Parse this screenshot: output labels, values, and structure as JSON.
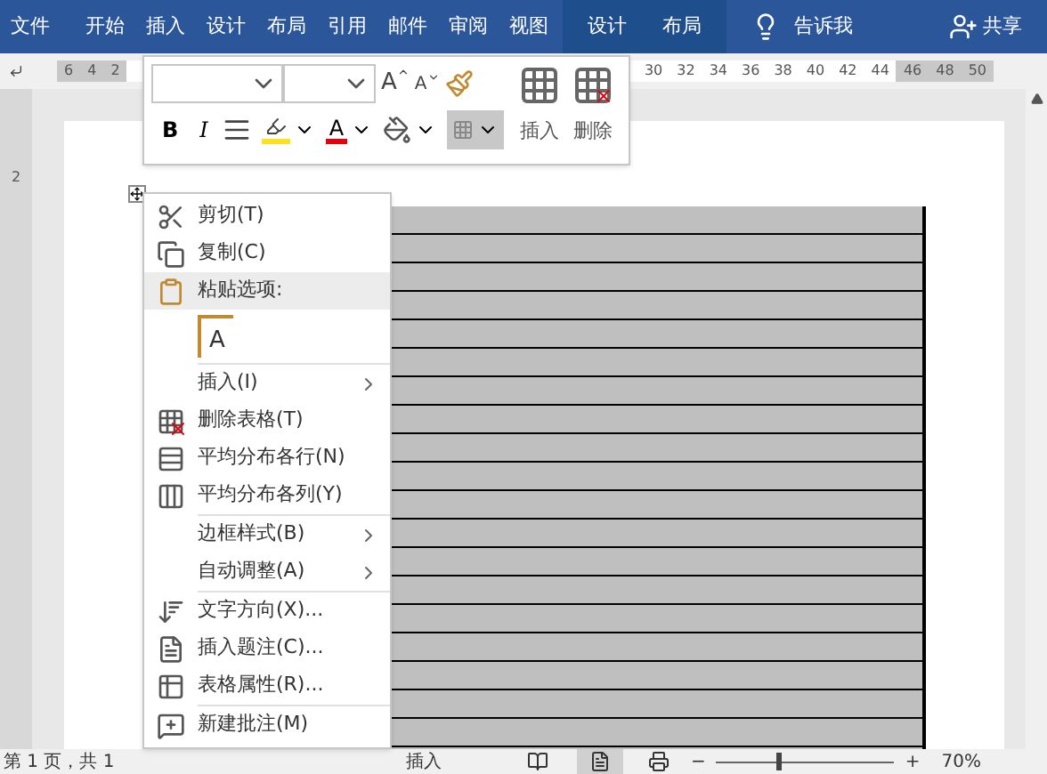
{
  "ribbon_tabs": [
    {
      "label": "文件",
      "kind": "normal"
    },
    {
      "label": "开始",
      "kind": "normal"
    },
    {
      "label": "插入",
      "kind": "normal"
    },
    {
      "label": "设计",
      "kind": "normal"
    },
    {
      "label": "布局",
      "kind": "normal"
    },
    {
      "label": "引用",
      "kind": "normal"
    },
    {
      "label": "邮件",
      "kind": "normal"
    },
    {
      "label": "审阅",
      "kind": "normal"
    },
    {
      "label": "视图",
      "kind": "normal"
    },
    {
      "label": "设计",
      "kind": "contextual"
    },
    {
      "label": "布局",
      "kind": "contextual"
    }
  ],
  "tell_me": "告诉我",
  "share": "共享",
  "ruler": [
    {
      "label": "6",
      "margin": true
    },
    {
      "label": "4",
      "margin": true
    },
    {
      "label": "2",
      "margin": true
    },
    {
      "label": "30",
      "margin": false
    },
    {
      "label": "32",
      "margin": false
    },
    {
      "label": "34",
      "margin": false
    },
    {
      "label": "36",
      "margin": false
    },
    {
      "label": "38",
      "margin": false
    },
    {
      "label": "40",
      "margin": false
    },
    {
      "label": "42",
      "margin": false
    },
    {
      "label": "44",
      "margin": false
    },
    {
      "label": "46",
      "margin": true
    },
    {
      "label": "48",
      "margin": true
    },
    {
      "label": "50",
      "margin": true
    }
  ],
  "vertical_ruler": "2",
  "mini_toolbar": {
    "grow_font": "A",
    "shrink_font": "A",
    "bold": "B",
    "italic": "I",
    "font_color": "A",
    "borders_pressed": true,
    "insert": "插入",
    "delete": "删除"
  },
  "context_menu": [
    {
      "kind": "item",
      "label": "剪切(T)",
      "submenu": false,
      "divider_before": false
    },
    {
      "kind": "item",
      "label": "复制(C)",
      "submenu": false,
      "divider_before": false
    },
    {
      "kind": "header",
      "label": "粘贴选项:"
    },
    {
      "kind": "paste",
      "label": "A"
    },
    {
      "kind": "item",
      "label": "插入(I)",
      "submenu": true,
      "divider_before": true
    },
    {
      "kind": "item",
      "label": "删除表格(T)",
      "submenu": false,
      "divider_before": false
    },
    {
      "kind": "item",
      "label": "平均分布各行(N)",
      "submenu": false,
      "divider_before": false
    },
    {
      "kind": "item",
      "label": "平均分布各列(Y)",
      "submenu": false,
      "divider_before": false
    },
    {
      "kind": "item",
      "label": "边框样式(B)",
      "submenu": true,
      "divider_before": true
    },
    {
      "kind": "item",
      "label": "自动调整(A)",
      "submenu": true,
      "divider_before": false
    },
    {
      "kind": "item",
      "label": "文字方向(X)...",
      "submenu": false,
      "divider_before": true
    },
    {
      "kind": "item",
      "label": "插入题注(C)...",
      "submenu": false,
      "divider_before": false
    },
    {
      "kind": "item",
      "label": "表格属性(R)...",
      "submenu": false,
      "divider_before": false
    },
    {
      "kind": "item",
      "label": "新建批注(M)",
      "submenu": false,
      "divider_before": true
    }
  ],
  "status_bar": {
    "page": "第 1 页，共 1",
    "mode": "插入",
    "zoom_out": "−",
    "zoom_in": "+",
    "zoom": "70%",
    "zoom_slider": {
      "level": 0.35
    }
  }
}
